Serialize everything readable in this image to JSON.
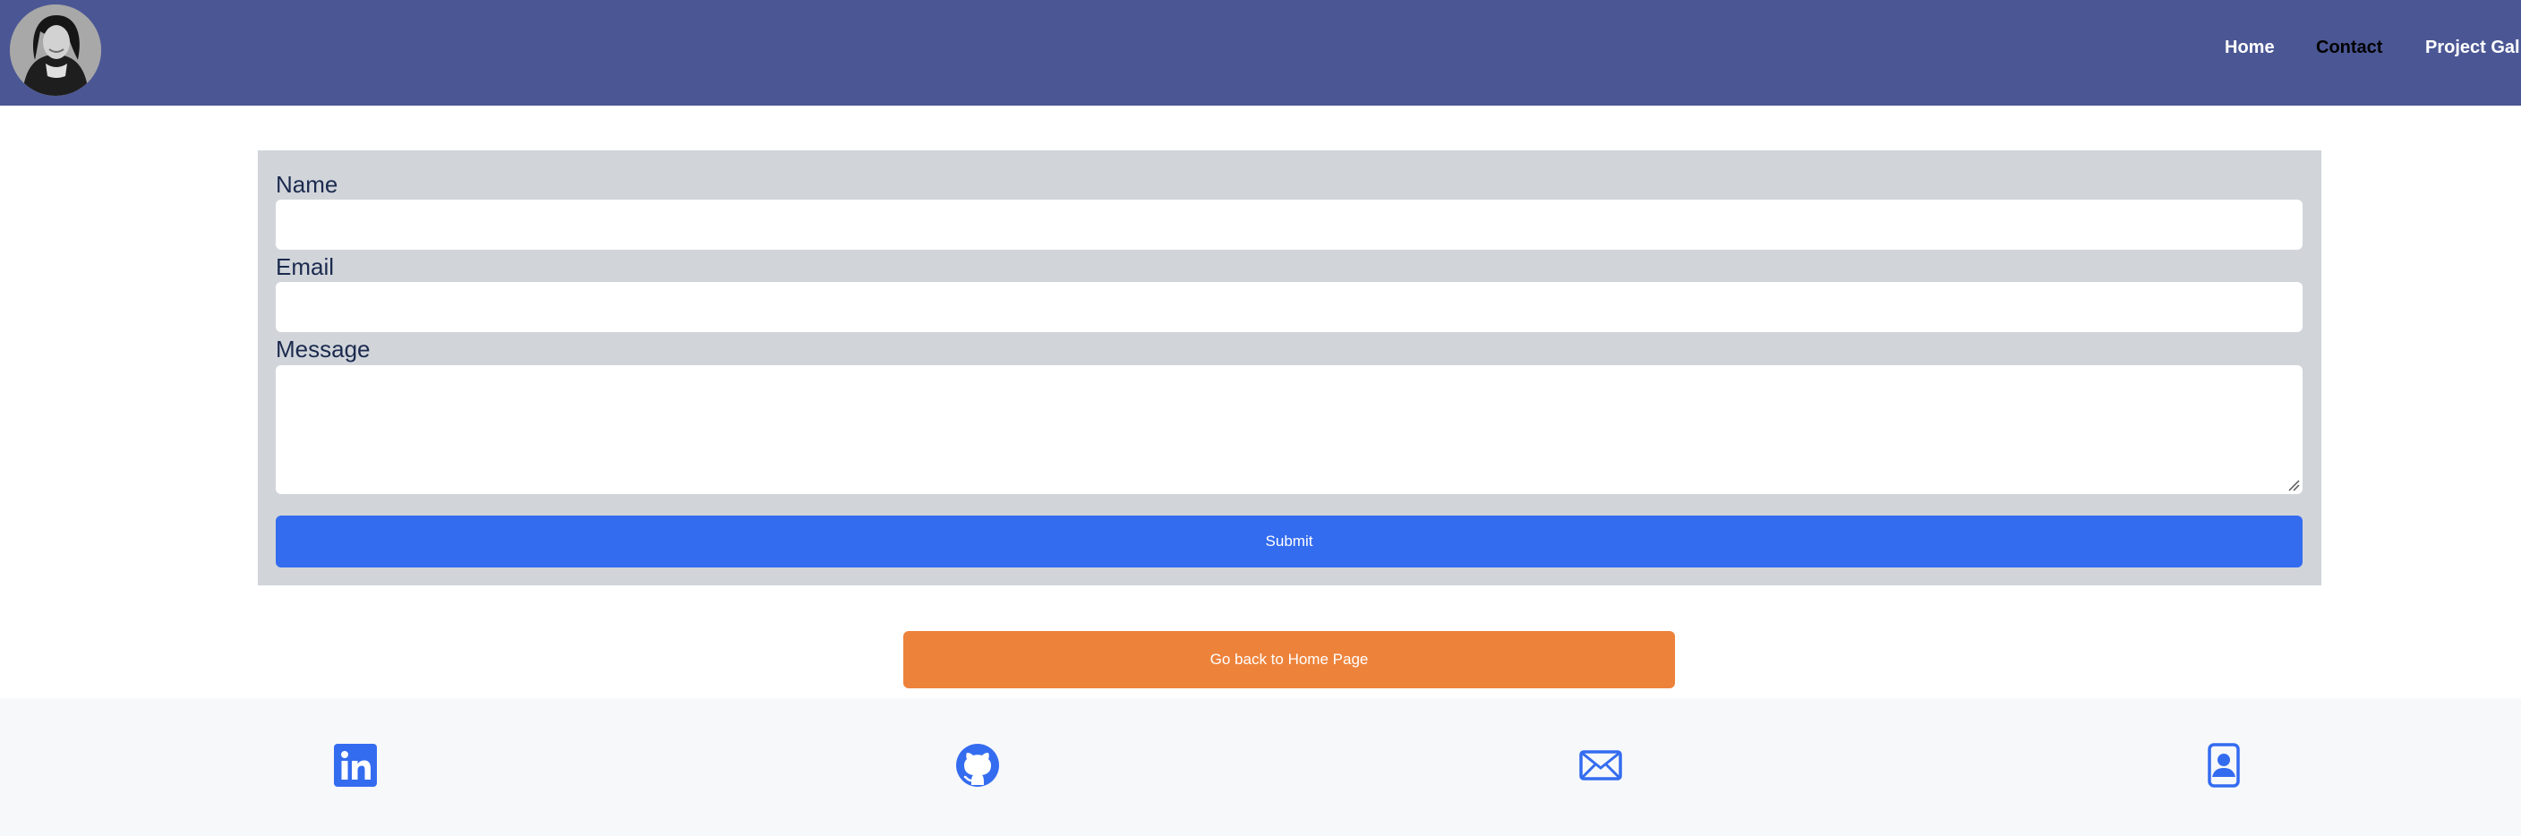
{
  "nav": {
    "links": [
      {
        "label": "Home"
      },
      {
        "label": "Contact",
        "active": true
      },
      {
        "label": "Project Gallery"
      }
    ]
  },
  "form": {
    "name_label": "Name",
    "name_value": "",
    "email_label": "Email",
    "email_value": "",
    "message_label": "Message",
    "message_value": "",
    "submit_label": "Submit"
  },
  "back_button_label": "Go back to Home Page",
  "footer": {
    "icons": [
      "linkedin-icon",
      "github-icon",
      "mail-icon",
      "contact-card-icon"
    ]
  },
  "colors": {
    "navbar": "#4b5794",
    "panel": "#d1d5da",
    "submit": "#346cf0",
    "back_button": "#ed833b",
    "footer_icons": "#346cf0"
  }
}
